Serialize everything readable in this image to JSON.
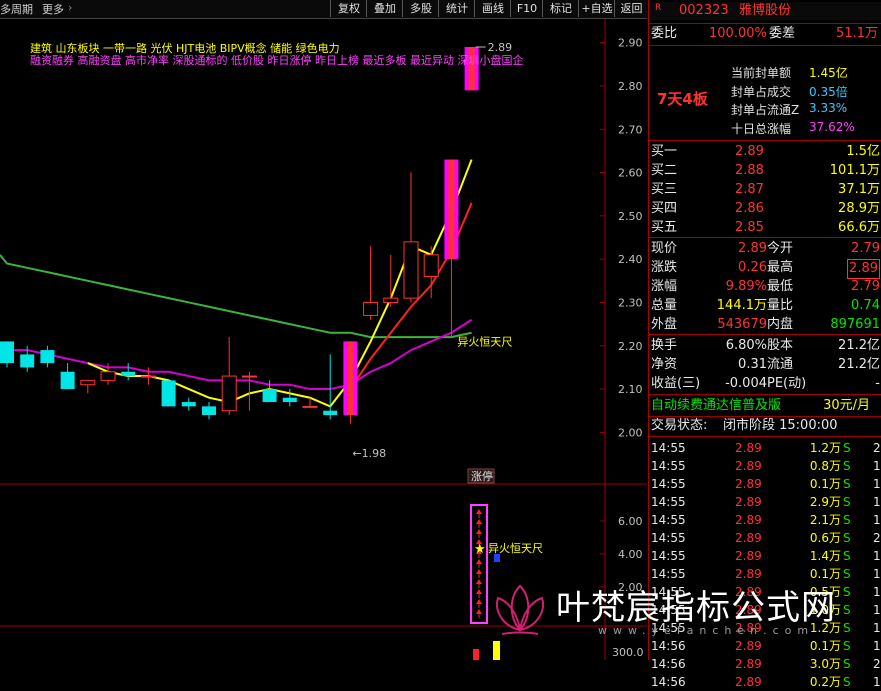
{
  "toolbar": {
    "period_label": "多周期",
    "more_label": "更多",
    "more_arrow": "›",
    "buttons": [
      "复权",
      "叠加",
      "多股",
      "统计",
      "画线",
      "F10",
      "标记",
      "+自选",
      "返回"
    ]
  },
  "chart": {
    "concepts_line1": "建筑      山东板块   一带一路 光伏 HJT电池 BIPV概念 储能 绿色电力",
    "concepts_line2": "融资融券 高融资盘 高市净率 深股通标的 低价股 昨日涨停 昨日上榜 最近多板 最近异动 深圳小盘国企",
    "price_axis": [
      "2.90",
      "2.80",
      "2.70",
      "2.60",
      "2.50",
      "2.40",
      "2.30",
      "2.20",
      "2.10",
      "2.00"
    ],
    "high_marker": "2.89",
    "low_marker": "1.98",
    "signal_label": "异火恒天尺",
    "limit_up_badge": "涨停",
    "lower_axis": [
      "6.00",
      "4.00",
      "2.00"
    ],
    "lower_signal_label": "异火恒天尺",
    "volume_axis": "300.0",
    "colors": {
      "up": "#ff3232",
      "down": "#00e6e6",
      "limit": "#ff00ff",
      "ma_yellow": "#ffff00",
      "ma_red": "#ff2020",
      "ma_green": "#3cb43c",
      "ma_magenta": "#d400d4"
    }
  },
  "chart_data": {
    "type": "candlestick",
    "ylim": [
      1.95,
      2.92
    ],
    "candles": [
      {
        "o": 2.21,
        "h": 2.21,
        "l": 2.15,
        "c": 2.16
      },
      {
        "o": 2.18,
        "h": 2.2,
        "l": 2.14,
        "c": 2.15
      },
      {
        "o": 2.19,
        "h": 2.2,
        "l": 2.15,
        "c": 2.16
      },
      {
        "o": 2.14,
        "h": 2.16,
        "l": 2.1,
        "c": 2.1
      },
      {
        "o": 2.11,
        "h": 2.12,
        "l": 2.09,
        "c": 2.12
      },
      {
        "o": 2.12,
        "h": 2.16,
        "l": 2.11,
        "c": 2.14
      },
      {
        "o": 2.14,
        "h": 2.16,
        "l": 2.12,
        "c": 2.13
      },
      {
        "o": 2.13,
        "h": 2.15,
        "l": 2.11,
        "c": 2.13
      },
      {
        "o": 2.12,
        "h": 2.12,
        "l": 2.06,
        "c": 2.06
      },
      {
        "o": 2.07,
        "h": 2.08,
        "l": 2.05,
        "c": 2.06
      },
      {
        "o": 2.06,
        "h": 2.07,
        "l": 2.03,
        "c": 2.04
      },
      {
        "o": 2.05,
        "h": 2.22,
        "l": 2.04,
        "c": 2.13
      },
      {
        "o": 2.13,
        "h": 2.14,
        "l": 2.05,
        "c": 2.13
      },
      {
        "o": 2.1,
        "h": 2.12,
        "l": 2.07,
        "c": 2.07
      },
      {
        "o": 2.08,
        "h": 2.1,
        "l": 2.06,
        "c": 2.07
      },
      {
        "o": 2.06,
        "h": 2.08,
        "l": 2.06,
        "c": 2.06
      },
      {
        "o": 2.05,
        "h": 2.18,
        "l": 2.03,
        "c": 2.04
      },
      {
        "o": 2.04,
        "h": 2.21,
        "l": 2.02,
        "c": 2.21
      },
      {
        "o": 2.27,
        "h": 2.43,
        "l": 2.26,
        "c": 2.3
      },
      {
        "o": 2.3,
        "h": 2.41,
        "l": 2.29,
        "c": 2.31
      },
      {
        "o": 2.31,
        "h": 2.6,
        "l": 2.3,
        "c": 2.44
      },
      {
        "o": 2.36,
        "h": 2.43,
        "l": 2.31,
        "c": 2.41
      },
      {
        "o": 2.4,
        "h": 2.63,
        "l": 2.22,
        "c": 2.63
      },
      {
        "o": 2.79,
        "h": 2.89,
        "l": 2.79,
        "c": 2.89
      }
    ],
    "ma_yellow": [
      null,
      null,
      null,
      null,
      2.16,
      2.14,
      2.13,
      2.13,
      2.12,
      2.1,
      2.08,
      2.07,
      2.09,
      2.1,
      2.09,
      2.08,
      2.06,
      2.12,
      2.21,
      2.31,
      2.43,
      2.41,
      2.51,
      2.63
    ],
    "ma_red": [
      null,
      null,
      null,
      null,
      null,
      null,
      null,
      null,
      null,
      null,
      null,
      null,
      null,
      null,
      null,
      null,
      null,
      2.1,
      2.17,
      2.23,
      2.29,
      2.34,
      2.42,
      2.53
    ],
    "ma_magenta": [
      2.19,
      2.19,
      2.18,
      2.17,
      2.16,
      2.15,
      2.15,
      2.14,
      2.14,
      2.13,
      2.12,
      2.12,
      2.12,
      2.11,
      2.11,
      2.1,
      2.1,
      2.11,
      2.14,
      2.16,
      2.19,
      2.21,
      2.23,
      2.26
    ],
    "ma_green": [
      2.39,
      2.38,
      2.37,
      2.36,
      2.35,
      2.34,
      2.33,
      2.32,
      2.31,
      2.3,
      2.29,
      2.28,
      2.27,
      2.26,
      2.25,
      2.24,
      2.23,
      2.23,
      2.22,
      2.22,
      2.22,
      2.22,
      2.22,
      2.23
    ]
  },
  "quote": {
    "market_tag": "R",
    "code": "002323",
    "name": "雅博股份",
    "weibi_label": "委比",
    "weibi_value": "100.00%",
    "weicha_label": "委差",
    "weicha_value": "51.1万",
    "streak": "7天4板",
    "seal_rows": [
      {
        "label": "当前封单额",
        "value": "1.45亿",
        "color": "#ffff00"
      },
      {
        "label": "封单占成交",
        "value": "0.35倍",
        "color": "#3cc8ff"
      },
      {
        "label": "封单占流通Z",
        "value": "3.33%",
        "color": "#3cc8ff"
      },
      {
        "label": "十日总涨幅",
        "value": "37.62%",
        "color": "#ff40ff"
      }
    ],
    "bids": [
      {
        "label": "买一",
        "price": "2.89",
        "vol": "1.5亿"
      },
      {
        "label": "买二",
        "price": "2.88",
        "vol": "101.1万"
      },
      {
        "label": "买三",
        "price": "2.87",
        "vol": "37.1万"
      },
      {
        "label": "买四",
        "price": "2.86",
        "vol": "28.9万"
      },
      {
        "label": "买五",
        "price": "2.85",
        "vol": "66.6万"
      }
    ],
    "stats": [
      {
        "l1": "现价",
        "v1": "2.89",
        "c1": "red",
        "l2": "今开",
        "v2": "2.79",
        "c2": "red"
      },
      {
        "l1": "涨跌",
        "v1": "0.26",
        "c1": "red",
        "l2": "最高",
        "v2": "2.89",
        "c2": "red"
      },
      {
        "l1": "涨幅",
        "v1": "9.89%",
        "c1": "red",
        "l2": "最低",
        "v2": "2.79",
        "c2": "red"
      },
      {
        "l1": "总量",
        "v1": "144.1万",
        "c1": "yel",
        "l2": "量比",
        "v2": "0.74",
        "c2": "grn"
      },
      {
        "l1": "外盘",
        "v1": "543679",
        "c1": "red",
        "l2": "内盘",
        "v2": "897691",
        "c2": "grn"
      }
    ],
    "stats2": [
      {
        "l1": "换手",
        "v1": "6.80%",
        "c1": "wht",
        "l2": "股本",
        "v2": "21.2亿",
        "c2": "wht"
      },
      {
        "l1": "净资",
        "v1": "0.31",
        "c1": "wht",
        "l2": "流通",
        "v2": "21.2亿",
        "c2": "wht"
      },
      {
        "l1": "收益(三)",
        "v1": "-0.004",
        "c1": "wht",
        "l2": "PE(动)",
        "v2": "-",
        "c2": "wht"
      }
    ],
    "promo_left": "自动续费通达信普及版",
    "promo_right": "30元/月",
    "status_label": "交易状态:",
    "status_value": "闭市阶段 15:00:00",
    "ticks": [
      {
        "t": "14:55",
        "p": "2.89",
        "v": "1.2万",
        "s": "S",
        "n": "2"
      },
      {
        "t": "14:55",
        "p": "2.89",
        "v": "0.8万",
        "s": "S",
        "n": "1"
      },
      {
        "t": "14:55",
        "p": "2.89",
        "v": "0.1万",
        "s": "S",
        "n": "1"
      },
      {
        "t": "14:55",
        "p": "2.89",
        "v": "2.9万",
        "s": "S",
        "n": "1"
      },
      {
        "t": "14:55",
        "p": "2.89",
        "v": "2.1万",
        "s": "S",
        "n": "1"
      },
      {
        "t": "14:55",
        "p": "2.89",
        "v": "0.6万",
        "s": "S",
        "n": "2"
      },
      {
        "t": "14:55",
        "p": "2.89",
        "v": "1.4万",
        "s": "S",
        "n": "1"
      },
      {
        "t": "14:55",
        "p": "2.89",
        "v": "0.1万",
        "s": "S",
        "n": "1"
      },
      {
        "t": "14:55",
        "p": "2.89",
        "v": "0.5万",
        "s": "S",
        "n": "1"
      },
      {
        "t": "14:55",
        "p": "2.89",
        "v": "1.0万",
        "s": "S",
        "n": "1"
      },
      {
        "t": "14:55",
        "p": "2.89",
        "v": "1.2万",
        "s": "S",
        "n": "1"
      },
      {
        "t": "14:56",
        "p": "2.89",
        "v": "0.1万",
        "s": "S",
        "n": "1"
      },
      {
        "t": "14:56",
        "p": "2.89",
        "v": "3.0万",
        "s": "S",
        "n": "2"
      },
      {
        "t": "14:56",
        "p": "2.89",
        "v": "0.2万",
        "s": "S",
        "n": "1"
      }
    ]
  },
  "watermark": {
    "text": "叶梵宸指标公式网",
    "sub": "www.yefanchen.com"
  }
}
